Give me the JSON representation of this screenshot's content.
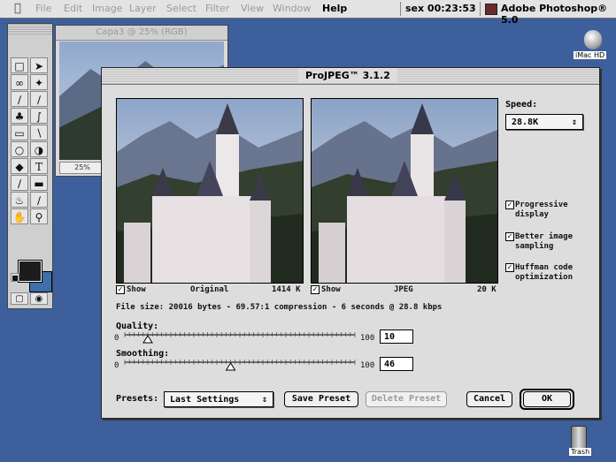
{
  "menubar": {
    "items": [
      "File",
      "Edit",
      "Image",
      "Layer",
      "Select",
      "Filter",
      "View",
      "Window",
      "Help"
    ],
    "clock": "sex 00:23:53",
    "app_name": "Adobe Photoshop® 5.0"
  },
  "desktop": {
    "hd_label": "iMac HD",
    "trash_label": "Trash"
  },
  "document": {
    "title": "Capa3 @ 25% (RGB)",
    "zoom": "25%"
  },
  "dialog": {
    "title": "ProJPEG™ 3.1.2",
    "speed_label": "Speed:",
    "speed_value": "28.8K",
    "checks": [
      {
        "label_line1": "Progressive",
        "label_line2": "display",
        "checked": true
      },
      {
        "label_line1": "Better image",
        "label_line2": "sampling",
        "checked": true
      },
      {
        "label_line1": "Huffman code",
        "label_line2": "optimization",
        "checked": true
      }
    ],
    "left_preview": {
      "show_label": "Show",
      "name": "Original",
      "size": "1414 K",
      "show_checked": true
    },
    "right_preview": {
      "show_label": "Show",
      "name": "JPEG",
      "size": "20 K",
      "show_checked": true
    },
    "file_info": "File size: 20016 bytes - 69.57:1 compression - 6 seconds @ 28.8 kbps",
    "quality": {
      "label": "Quality:",
      "min": "0",
      "max": "100",
      "value": "10",
      "level": 0.1
    },
    "smoothing": {
      "label": "Smoothing:",
      "min": "0",
      "max": "100",
      "value": "46",
      "level": 0.46
    },
    "presets_label": "Presets:",
    "presets_value": "Last Settings",
    "save_preset": "Save Preset",
    "delete_preset": "Delete Preset",
    "cancel": "Cancel",
    "ok": "OK"
  },
  "colors": {
    "desktop": "#3d5f9c",
    "foreground": "#1c1c1c",
    "background": "#3f6fa9"
  }
}
